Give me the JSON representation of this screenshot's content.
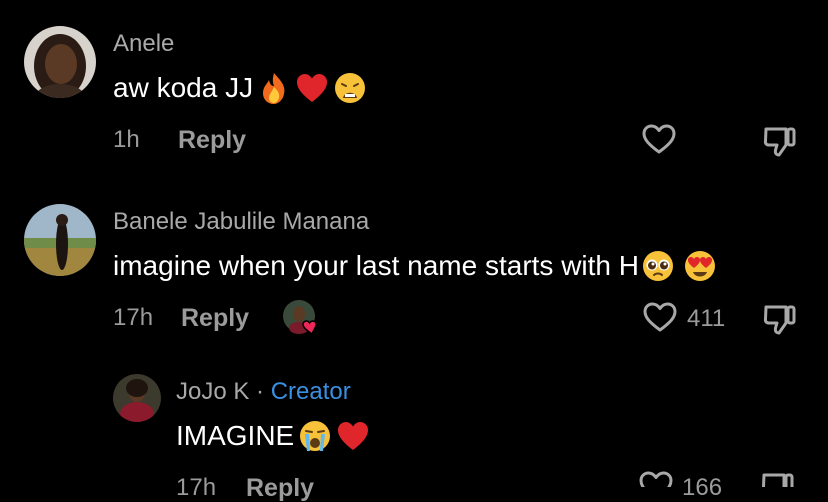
{
  "comments": [
    {
      "author": "Anele",
      "text": "aw koda JJ",
      "emojis": [
        "fire-emoji",
        "red-heart-emoji",
        "weary-face-emoji"
      ],
      "time": "1h",
      "reply_label": "Reply"
    },
    {
      "author": "Banele Jabulile Manana",
      "text": "imagine when your last name starts with H",
      "emojis": [
        "pleading-face-emoji",
        "heart-eyes-emoji"
      ],
      "time": "17h",
      "reply_label": "Reply",
      "like_count": "411"
    }
  ],
  "reply": {
    "author": "JoJo K",
    "separator": "·",
    "badge": "Creator",
    "text": "IMAGINE",
    "emojis": [
      "loudly-crying-face-emoji",
      "red-heart-emoji"
    ],
    "time": "17h",
    "reply_label": "Reply",
    "like_count": "166"
  },
  "colors": {
    "background": "#000000",
    "secondary_text": "#9b9b9b",
    "creator_badge": "#3a8fe0"
  }
}
